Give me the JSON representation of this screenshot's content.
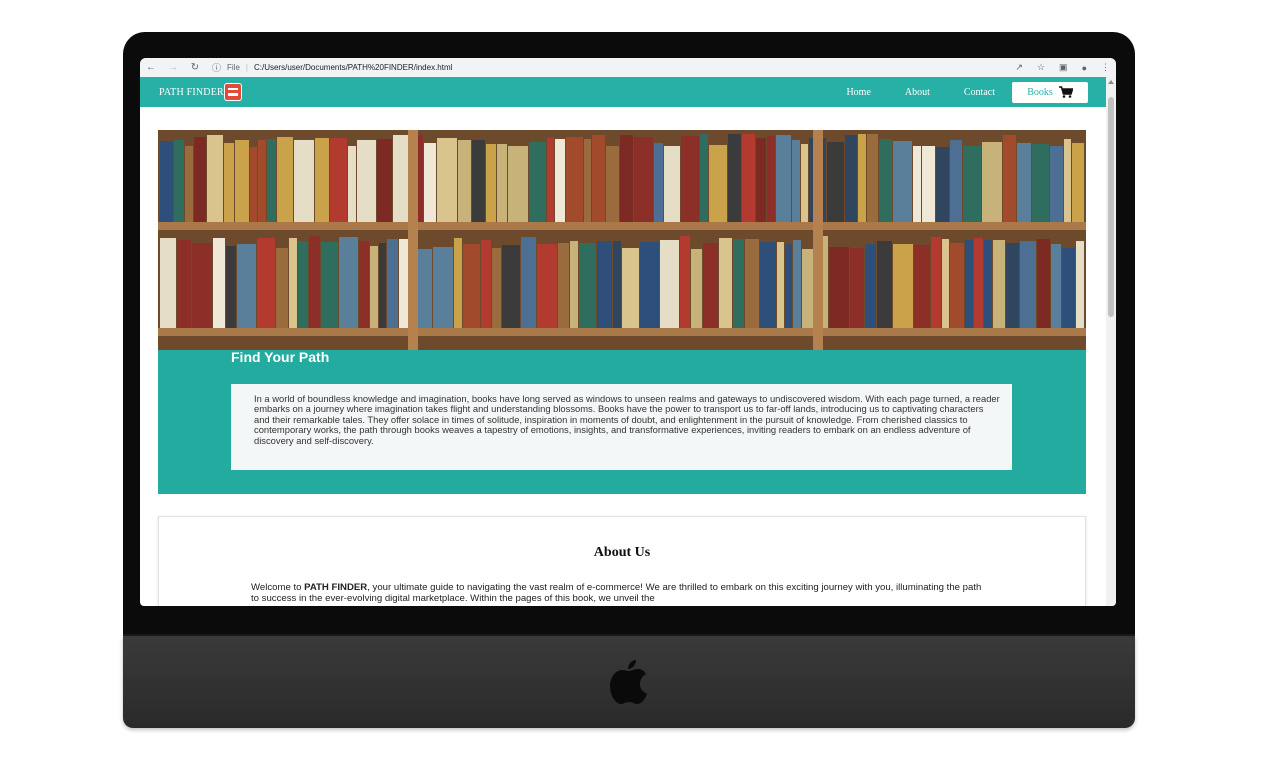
{
  "browser": {
    "address_info": "ⓘ",
    "address_scheme": "File",
    "address_url": "C:/Users/user/Documents/PATH%20FINDER/index.html"
  },
  "site": {
    "brand": "PATH FINDER",
    "nav": {
      "home": "Home",
      "about": "About",
      "contact": "Contact",
      "books": "Books"
    },
    "hero": {
      "title": "Find Your Path",
      "text": "In a world of boundless knowledge and imagination, books have long served as windows to unseen realms and gateways to undiscovered wisdom. With each page turned, a reader embarks on a journey where imagination takes flight and understanding blossoms. Books have the power to transport us to far-off lands, introducing us to captivating characters and their remarkable tales. They offer solace in times of solitude, inspiration in moments of doubt, and enlightenment in the pursuit of knowledge. From cherished classics to contemporary works, the path through books weaves a tapestry of emotions, insights, and transformative experiences, inviting readers to embark on an endless adventure of discovery and self-discovery."
    },
    "about": {
      "title": "About Us",
      "text_prefix": "Welcome to ",
      "text_brand": "PATH FINDER",
      "text_rest": ", your ultimate guide to navigating the vast realm of e-commerce! We are thrilled to embark on this exciting journey with you, illuminating the path to success in the ever-evolving digital marketplace. Within the pages of this book, we unveil the"
    }
  },
  "colors": {
    "brand_teal": "#26b0a6",
    "brand_icon_red": "#e24a3b"
  }
}
